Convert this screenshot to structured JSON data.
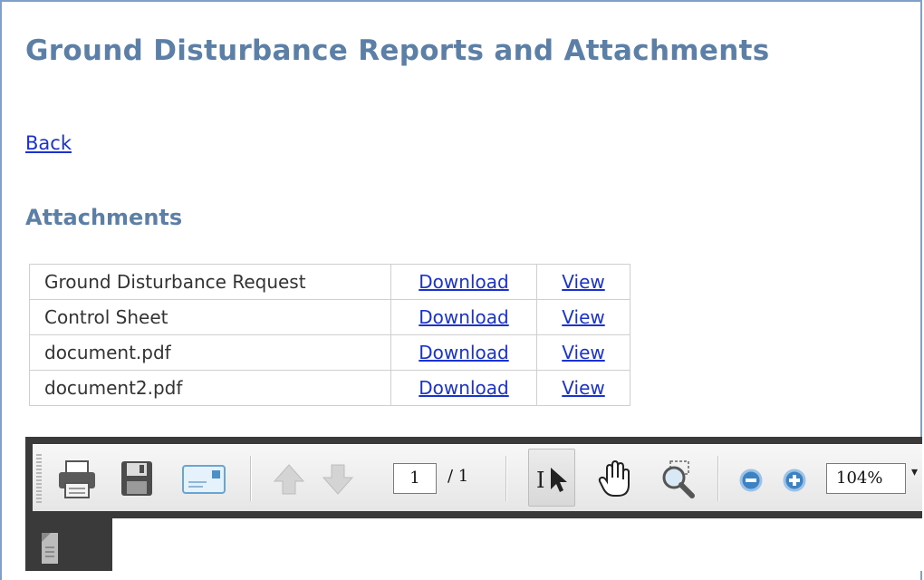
{
  "page": {
    "title": "Ground Disturbance Reports and Attachments",
    "back_label": "Back",
    "section_title": "Attachments"
  },
  "attachments": [
    {
      "name": "Ground Disturbance Request",
      "download": "Download",
      "view": "View"
    },
    {
      "name": "Control Sheet",
      "download": "Download",
      "view": "View"
    },
    {
      "name": "document.pdf",
      "download": "Download",
      "view": "View"
    },
    {
      "name": "document2.pdf",
      "download": "Download",
      "view": "View"
    }
  ],
  "viewer": {
    "page_number": "1",
    "page_total": "/ 1",
    "zoom": "104%",
    "zoom_dropdown": "▾",
    "icons": [
      "print-icon",
      "save-icon",
      "email-icon",
      "previous-page-icon",
      "next-page-icon",
      "select-tool-icon",
      "hand-tool-icon",
      "marquee-zoom-icon",
      "zoom-out-icon",
      "zoom-in-icon",
      "pages-panel-icon"
    ]
  },
  "colors": {
    "heading": "#5b7fa6",
    "link": "#1a33cc",
    "frame": "#7fa0c8",
    "viewer_dark": "#3a3a3a"
  }
}
